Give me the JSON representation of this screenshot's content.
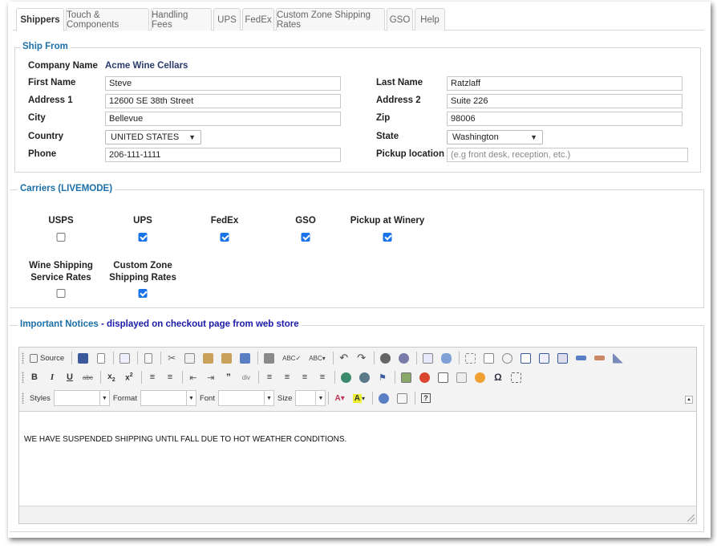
{
  "tabs": [
    {
      "label": "Shippers",
      "active": true
    },
    {
      "label": "Touch & Components"
    },
    {
      "label": "Handling Fees"
    },
    {
      "label": "UPS"
    },
    {
      "label": "FedEx"
    },
    {
      "label": "Custom Zone Shipping Rates"
    },
    {
      "label": "GSO"
    },
    {
      "label": "Help"
    }
  ],
  "ship_from": {
    "legend": "Ship From",
    "company_label": "Company Name",
    "company_value": "Acme Wine Cellars",
    "first_name_label": "First Name",
    "first_name": "Steve",
    "last_name_label": "Last Name",
    "last_name": "Ratzlaff",
    "address1_label": "Address 1",
    "address1": "12600 SE 38th Street",
    "address2_label": "Address 2",
    "address2": "Suite 226",
    "city_label": "City",
    "city": "Bellevue",
    "zip_label": "Zip",
    "zip": "98006",
    "country_label": "Country",
    "country": "UNITED STATES",
    "state_label": "State",
    "state": "Washington",
    "phone_label": "Phone",
    "phone": "206-111-1111",
    "pickup_label": "Pickup location",
    "pickup_placeholder": "(e.g front desk, reception, etc.)"
  },
  "carriers": {
    "legend": "Carriers (LIVEMODE)",
    "items": [
      {
        "name": "USPS",
        "checked": false
      },
      {
        "name": "UPS",
        "checked": true
      },
      {
        "name": "FedEx",
        "checked": true
      },
      {
        "name": "GSO",
        "checked": true
      },
      {
        "name": "Pickup at Winery",
        "checked": true
      },
      {
        "name_line1": "Wine Shipping",
        "name_line2": "Service Rates",
        "checked": false
      },
      {
        "name_line1": "Custom Zone",
        "name_line2": "Shipping Rates",
        "checked": true
      }
    ]
  },
  "notices": {
    "legend": "Important Notices",
    "legend_sub": " - displayed on checkout page from web store",
    "toolbar": {
      "source_label": "Source",
      "styles_label": "Styles",
      "format_label": "Format",
      "font_label": "Font",
      "size_label": "Size"
    },
    "content": "WE HAVE SUSPENDED SHIPPING UNTIL FALL DUE TO HOT WEATHER CONDITIONS."
  },
  "colors": {
    "legend": "#1b6fa8",
    "checkbox_on": "#1a73e8"
  }
}
